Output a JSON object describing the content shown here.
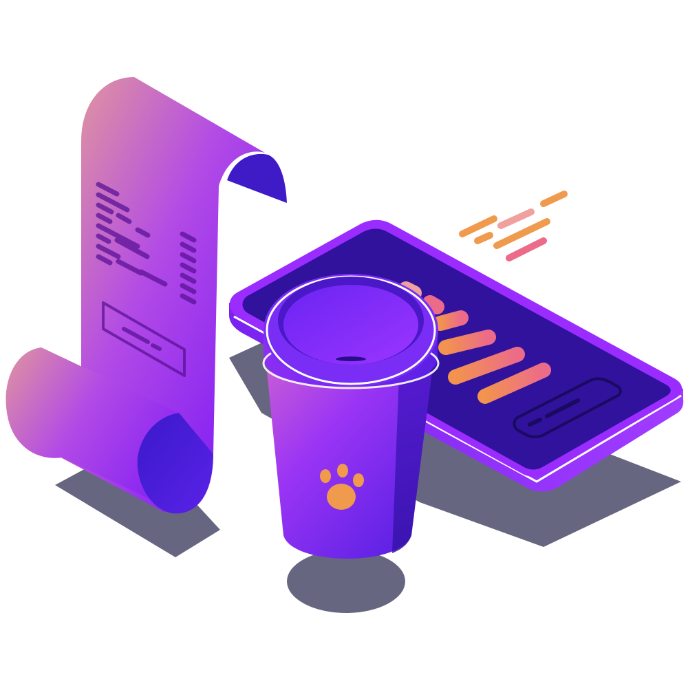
{
  "scene": {
    "description_elements": [
      "receipt",
      "smartphone",
      "coffee-cup",
      "motion-lines"
    ],
    "colors": {
      "background": "#ffffff",
      "shadow": "#676680",
      "receipt_light": "#d88aa6",
      "receipt_mid": "#b249e6",
      "receipt_dark": "#7617f5",
      "receipt_curl_inner": "#4a1bd8",
      "receipt_text": "#5a1296",
      "phone_screen": "#30129c",
      "phone_bezel": "#9a2cff",
      "phone_edge": "#4b10c9",
      "cup_body_light": "#b84fe0",
      "cup_body_dark": "#5b1ef0",
      "cup_lid": "#6d2df7",
      "cup_lid_rim": "#ffffff",
      "paw": "#f09a4e",
      "bar_orange": "#f2934f",
      "bar_pink": "#ec6b8a",
      "bar_peach": "#f0a19e"
    },
    "icons": {
      "cup_logo": "paw-icon"
    }
  }
}
